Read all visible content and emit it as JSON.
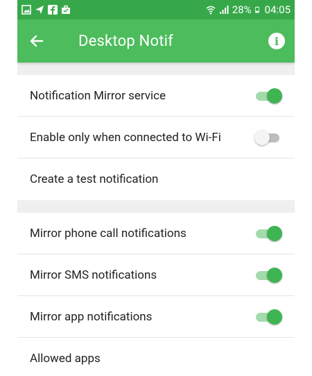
{
  "status_bar": {
    "battery": "28%",
    "time": "04:05",
    "left_icons": [
      "gallery-icon",
      "send-icon",
      "facebook-icon",
      "briefcase-icon"
    ],
    "right_icons": [
      "wifi-icon",
      "signal-icon",
      "battery-icon"
    ]
  },
  "app_bar": {
    "title": "Desktop Notif",
    "back_icon": "arrow-left-icon",
    "info_icon": "info-icon"
  },
  "sections": [
    {
      "rows": [
        {
          "label": "Notification Mirror service",
          "toggle": true
        },
        {
          "label": "Enable only when connected to Wi-Fi",
          "toggle": false
        },
        {
          "label": "Create a test notification"
        }
      ]
    },
    {
      "rows": [
        {
          "label": "Mirror phone call notifications",
          "toggle": true
        },
        {
          "label": "Mirror SMS notifications",
          "toggle": true
        },
        {
          "label": "Mirror app notifications",
          "toggle": true
        },
        {
          "label": "Allowed apps"
        }
      ]
    }
  ],
  "colors": {
    "status_bar": "#37a84a",
    "app_bar": "#4cbc5d",
    "toggle_on": "#3fb453",
    "toggle_off": "#bdbdbd"
  }
}
